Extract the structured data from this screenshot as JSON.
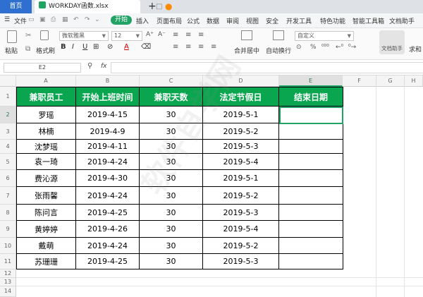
{
  "tabs": {
    "home": "首页",
    "file": "WORKDAY函数.xlsx"
  },
  "menu": {
    "file": "文件",
    "items": [
      "开始",
      "插入",
      "页面布局",
      "公式",
      "数据",
      "审阅",
      "视图",
      "安全",
      "开发工具",
      "特色功能",
      "智能工具箱",
      "文档助手"
    ],
    "active_index": 0
  },
  "ribbon": {
    "paste": "粘贴",
    "format_painter": "格式刷",
    "font_name": "微软雅黑",
    "font_size": "12",
    "merge_center": "合并居中",
    "wrap_text": "自动换行",
    "number_format": "自定义",
    "doc_assistant": "文档助手",
    "sum": "求和"
  },
  "formula_bar": {
    "name_box": "E2",
    "fx": "fx"
  },
  "columns": [
    "A",
    "B",
    "C",
    "D",
    "E",
    "F",
    "G",
    "H"
  ],
  "rows": [
    "1",
    "2",
    "3",
    "4",
    "5",
    "6",
    "7",
    "8",
    "9",
    "10",
    "11",
    "12",
    "13",
    "14"
  ],
  "table": {
    "headers": [
      "兼职员工",
      "开始上班时间",
      "兼职天数",
      "法定节假日",
      "结束日期"
    ],
    "data": [
      [
        "罗瑶",
        "2019-4-15",
        "30",
        "2019-5-1",
        ""
      ],
      [
        "林楠",
        "2019-4-9",
        "30",
        "2019-5-2",
        ""
      ],
      [
        "沈梦瑶",
        "2019-4-11",
        "30",
        "2019-5-3",
        ""
      ],
      [
        "袁一琦",
        "2019-4-24",
        "30",
        "2019-5-4",
        ""
      ],
      [
        "费沁源",
        "2019-4-30",
        "30",
        "2019-5-1",
        ""
      ],
      [
        "张雨馨",
        "2019-4-24",
        "30",
        "2019-5-2",
        ""
      ],
      [
        "陈问言",
        "2019-4-25",
        "30",
        "2019-5-3",
        ""
      ],
      [
        "黄婷婷",
        "2019-4-26",
        "30",
        "2019-5-4",
        ""
      ],
      [
        "戴萌",
        "2019-4-24",
        "30",
        "2019-5-2",
        ""
      ],
      [
        "苏珊珊",
        "2019-4-25",
        "30",
        "2019-5-3",
        ""
      ]
    ]
  },
  "colors": {
    "accent": "#21a366",
    "header_fill": "#0aa64f",
    "home_tab": "#2f6fd0"
  }
}
